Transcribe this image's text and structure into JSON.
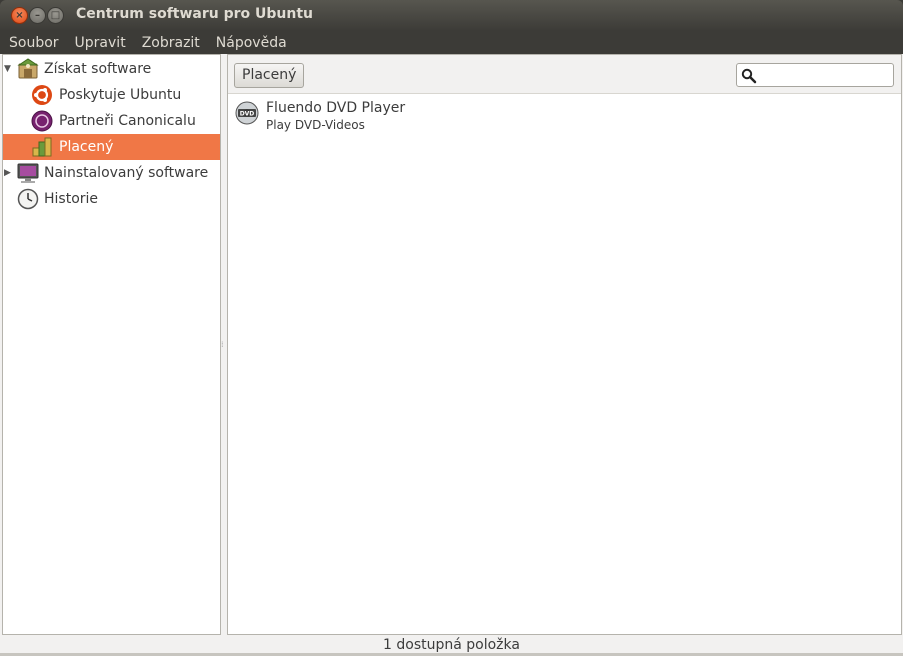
{
  "window": {
    "title": "Centrum softwaru pro Ubuntu",
    "close_glyph": "×",
    "minimize_glyph": "–",
    "maximize_glyph": "□"
  },
  "menubar": {
    "items": [
      "Soubor",
      "Upravit",
      "Zobrazit",
      "Nápověda"
    ]
  },
  "sidebar": {
    "items": [
      {
        "label": "Získat software",
        "icon": "get-software-icon",
        "expander": "▼"
      },
      {
        "label": "Poskytuje Ubuntu",
        "icon": "ubuntu-logo-icon"
      },
      {
        "label": "Partneři Canonicalu",
        "icon": "canonical-partners-icon"
      },
      {
        "label": "Placený",
        "icon": "paid-software-icon",
        "selected": true
      },
      {
        "label": "Nainstalovaný software",
        "icon": "computer-icon",
        "expander": "▶"
      },
      {
        "label": "Historie",
        "icon": "clock-icon"
      }
    ]
  },
  "toolbar": {
    "nav_button": "Placený",
    "search_placeholder": ""
  },
  "apps": [
    {
      "name": "Fluendo DVD Player",
      "summary": "Play DVD-Videos",
      "icon": "dvd-player-icon"
    }
  ],
  "status": {
    "text": "1 dostupná položka"
  },
  "colors": {
    "selection": "#f07746",
    "titlebar": "#3c3b37",
    "close_button": "#df4a16"
  }
}
